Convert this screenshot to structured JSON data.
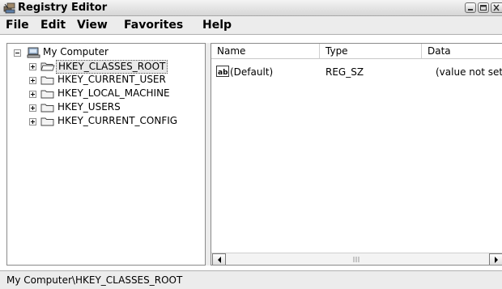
{
  "window": {
    "title": "Registry Editor",
    "icons": {
      "app": "registry-editor-icon",
      "minimize": "minimize-icon",
      "maximize": "maximize-icon",
      "close": "close-icon"
    }
  },
  "menu": {
    "items": [
      "File",
      "Edit",
      "View",
      "Favorites",
      "Help"
    ]
  },
  "tree": {
    "root": {
      "label": "My Computer",
      "icon": "computer-icon",
      "expanded": true
    },
    "keys": [
      {
        "label": "HKEY_CLASSES_ROOT",
        "selected": true,
        "icon": "folder-open-icon"
      },
      {
        "label": "HKEY_CURRENT_USER",
        "selected": false,
        "icon": "folder-icon"
      },
      {
        "label": "HKEY_LOCAL_MACHINE",
        "selected": false,
        "icon": "folder-icon"
      },
      {
        "label": "HKEY_USERS",
        "selected": false,
        "icon": "folder-icon"
      },
      {
        "label": "HKEY_CURRENT_CONFIG",
        "selected": false,
        "icon": "folder-icon"
      }
    ]
  },
  "list": {
    "columns": [
      "Name",
      "Type",
      "Data"
    ],
    "rows": [
      {
        "icon": "string-value-icon",
        "name": "(Default)",
        "type": "REG_SZ",
        "data": "(value not set)"
      }
    ]
  },
  "status": {
    "text": "My Computer\\HKEY_CLASSES_ROOT"
  },
  "colors": {
    "chrome": "#ececec",
    "border": "#8a8a8a",
    "selection": "#e8e8e8"
  }
}
